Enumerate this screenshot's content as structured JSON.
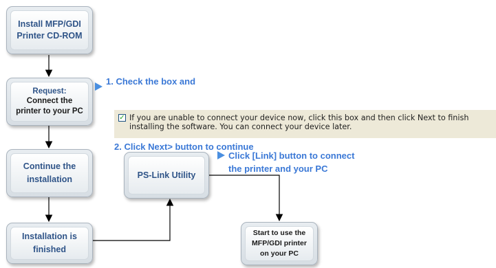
{
  "boxes": {
    "install": "Install MFP/GDI\nPrinter CD-ROM",
    "request_title": "Request:",
    "request_body": "Connect the\nprinter to your PC",
    "continue": "Continue the\ninstallation",
    "finished": "Installation is\nfinished",
    "ps_link": "PS-Link Utility",
    "start": "Start to use the\nMFP/GDI printer\non your PC"
  },
  "notes": {
    "step1": "1. Check the box and",
    "step2": "2. Click Next> button to continue",
    "link": "Click [Link] button to connect\nthe printer and your PC"
  },
  "dialog": {
    "checked": "✓",
    "text": "If you are unable to connect your device now, click this box and then click Next to finish\ninstalling the software. You can connect your device later."
  },
  "colors": {
    "box_text": "#2f5488",
    "note_blue": "#3a78d6",
    "dialog_bg": "#ede9d8"
  }
}
